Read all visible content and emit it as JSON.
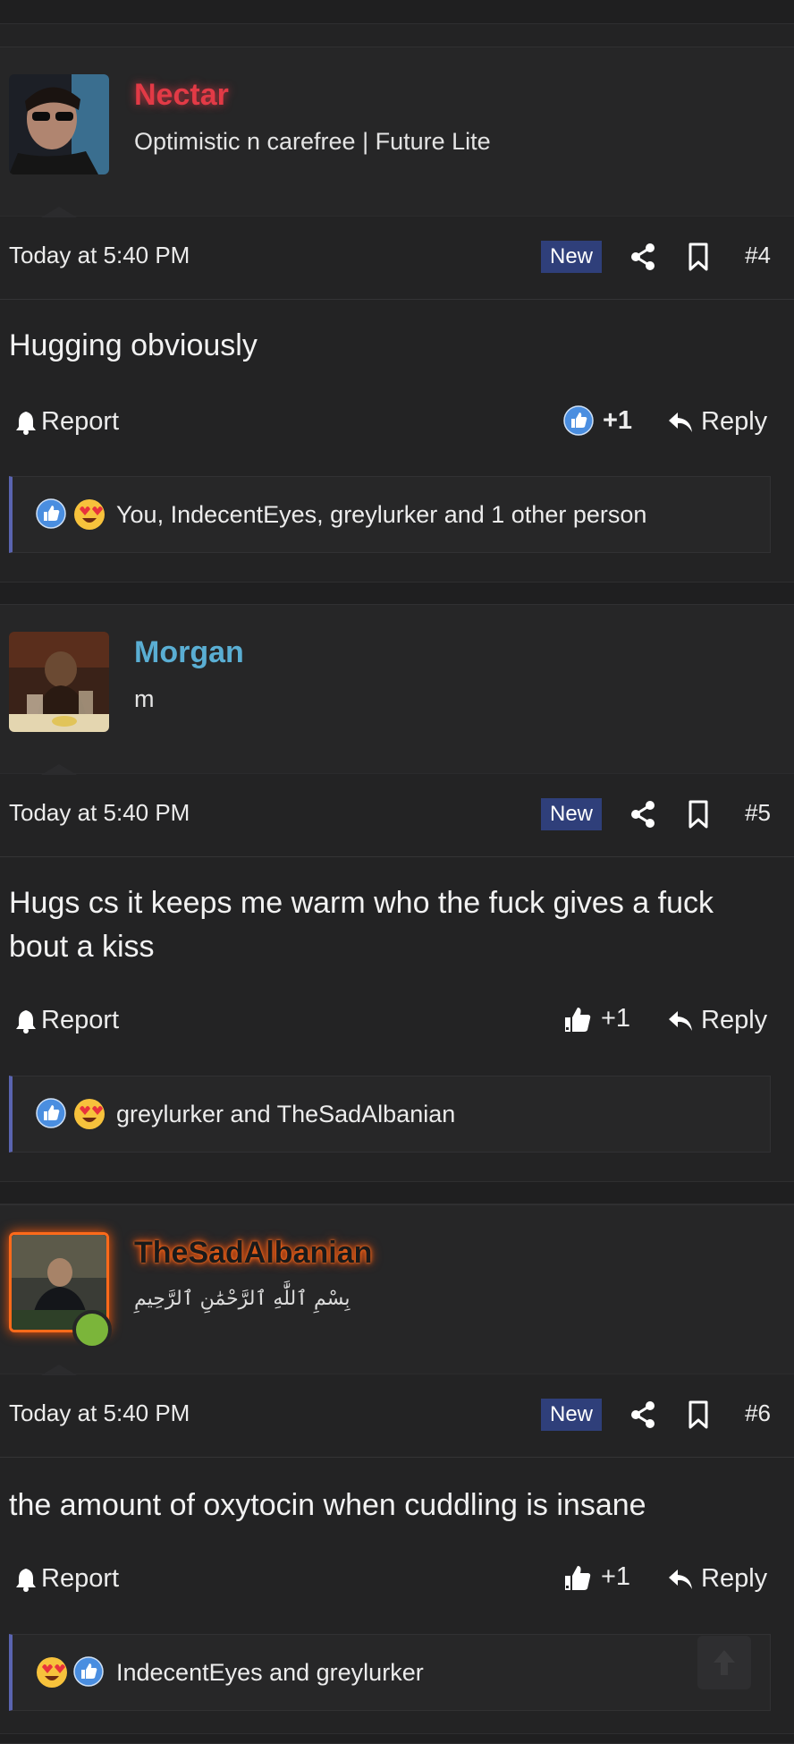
{
  "colors": {
    "nectar": "#e23a46",
    "morgan": "#5aaed3",
    "thesad": "#1a1a1a",
    "badge": "#2f3f7a",
    "reactbar_accent": "#5a64b0"
  },
  "posts": [
    {
      "username": "Nectar",
      "user_title": "Optimistic n carefree | Future Lite",
      "date": "Today at 5:40 PM",
      "badge": "New",
      "number": "#4",
      "body": "Hugging obviously",
      "report": "Report",
      "like": "+1",
      "reply": "Reply",
      "reactions_text": "You, IndecentEyes, greylurker and 1 other person",
      "reaction_icons": [
        "like-reaction-icon",
        "love-reaction-icon"
      ]
    },
    {
      "username": "Morgan",
      "user_title": "m",
      "date": "Today at 5:40 PM",
      "badge": "New",
      "number": "#5",
      "body": "Hugs cs it keeps me warm who the fuck gives a fuck bout a kiss",
      "report": "Report",
      "like": "+1",
      "reply": "Reply",
      "reactions_text": "greylurker and TheSadAlbanian",
      "reaction_icons": [
        "like-reaction-icon",
        "love-reaction-icon"
      ]
    },
    {
      "username": "TheSadAlbanian",
      "user_title": "بِسْمِ ٱللَّٰهِ ٱلرَّحْمَٰنِ ٱلرَّحِيمِ",
      "date": "Today at 5:40 PM",
      "badge": "New",
      "number": "#6",
      "body": "the amount of oxytocin when cuddling is insane",
      "report": "Report",
      "like": "+1",
      "reply": "Reply",
      "reactions_text": "IndecentEyes and greylurker",
      "reaction_icons": [
        "love-reaction-icon",
        "like-reaction-icon"
      ]
    }
  ]
}
